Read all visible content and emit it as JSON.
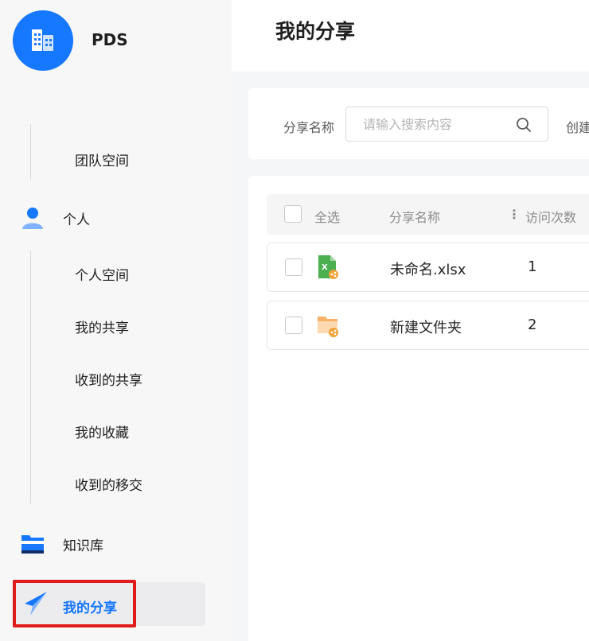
{
  "app": {
    "brand": "PDS"
  },
  "sidebar": {
    "items": [
      {
        "label": "团队空间"
      },
      {
        "label": "个人"
      },
      {
        "label": "个人空间"
      },
      {
        "label": "我的共享"
      },
      {
        "label": "收到的共享"
      },
      {
        "label": "我的收藏"
      },
      {
        "label": "收到的移交"
      },
      {
        "label": "知识库"
      },
      {
        "label": "我的分享"
      }
    ]
  },
  "header": {
    "title": "我的分享"
  },
  "filters": {
    "share_name_label": "分享名称",
    "search_placeholder": "请输入搜索内容",
    "created_label_partial": "创建"
  },
  "table": {
    "columns": {
      "select_all": "全选",
      "name": "分享名称",
      "visits": "访问次数"
    },
    "rows": [
      {
        "name": "未命名.xlsx",
        "visits": "1",
        "icon": "shared-excel-file-icon"
      },
      {
        "name": "新建文件夹",
        "visits": "2",
        "icon": "shared-folder-icon"
      }
    ]
  },
  "colors": {
    "accent": "#1677ff",
    "highlight_border": "#e01b1b"
  }
}
